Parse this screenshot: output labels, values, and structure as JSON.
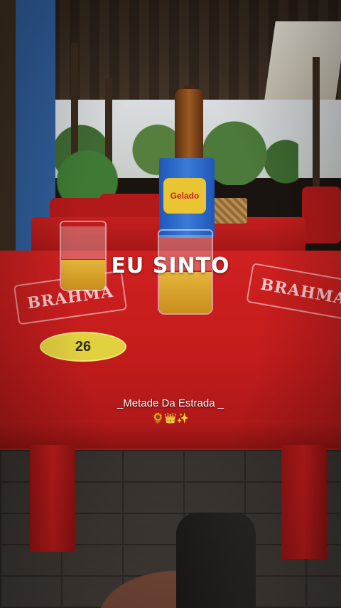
{
  "overlay": {
    "caption_main": "EU SINTO",
    "caption_sub": "_Metade Da Estrada _",
    "emojis": {
      "flower": "🌻",
      "crown": "👑",
      "sparkle": "✨"
    }
  },
  "scene": {
    "table_number": "26",
    "table_brand": "BRAHMA",
    "cup_label": "Gelado"
  },
  "colors": {
    "table_red": "#cf2020",
    "caption_text": "#ffffff",
    "sticker_yellow": "#e2d13f"
  }
}
